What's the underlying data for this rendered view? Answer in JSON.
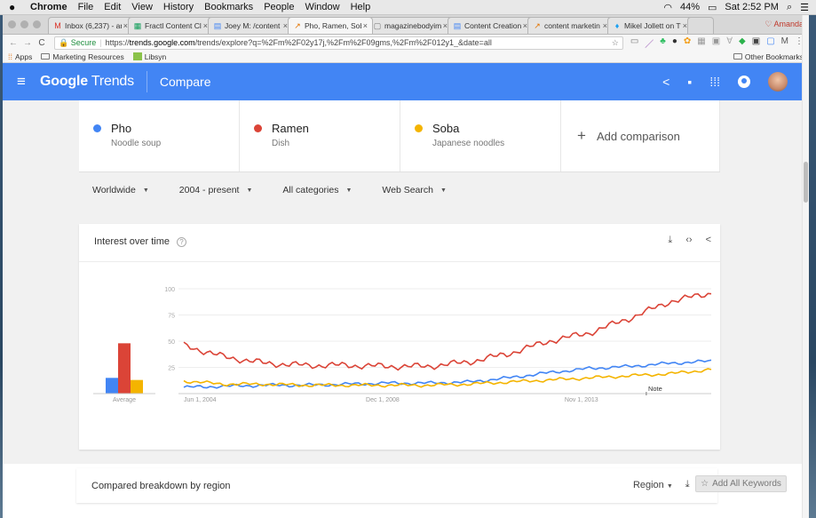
{
  "menubar": {
    "items": [
      "Chrome",
      "File",
      "Edit",
      "View",
      "History",
      "Bookmarks",
      "People",
      "Window",
      "Help"
    ],
    "battery": "44%",
    "clock": "Sat 2:52 PM"
  },
  "tabs": [
    {
      "label": "Inbox (6,237) - ar",
      "icon": "gmail-icon",
      "glyph": "M",
      "color": "#d93025"
    },
    {
      "label": "Fractl Content Cl",
      "icon": "sheets-icon",
      "glyph": "▦",
      "color": "#0f9d58"
    },
    {
      "label": "Joey M: /content",
      "icon": "docs-icon",
      "glyph": "▤",
      "color": "#4285f4"
    },
    {
      "label": "Pho, Ramen, Sob",
      "icon": "trends-icon",
      "glyph": "↗",
      "color": "#e37400",
      "active": true
    },
    {
      "label": "magazinebodyim",
      "icon": "page-icon",
      "glyph": "▢",
      "color": "#777777"
    },
    {
      "label": "Content Creation",
      "icon": "docs-icon",
      "glyph": "▤",
      "color": "#4285f4"
    },
    {
      "label": "content marketin",
      "icon": "trends-icon",
      "glyph": "↗",
      "color": "#e37400"
    },
    {
      "label": "Mikel Jollett on Tv",
      "icon": "twitter-icon",
      "glyph": "♦",
      "color": "#1da1f2"
    }
  ],
  "profile_name": "Amanda",
  "address": {
    "secure_label": "Secure",
    "url_prefix": "https://",
    "url_host": "trends.google.com",
    "url_path": "/trends/explore?q=%2Fm%2F02y17j,%2Fm%2F09gms,%2Fm%2F012y1_&date=all"
  },
  "bookmarks": {
    "apps": "Apps",
    "marketing": "Marketing Resources",
    "libsyn": "Libsyn",
    "other": "Other Bookmarks"
  },
  "header": {
    "logo_google": "Google",
    "logo_trends": "Trends",
    "section": "Compare"
  },
  "terms": [
    {
      "name": "Pho",
      "sub": "Noodle soup",
      "color": "#4285f4"
    },
    {
      "name": "Ramen",
      "sub": "Dish",
      "color": "#db4437"
    },
    {
      "name": "Soba",
      "sub": "Japanese noodles",
      "color": "#f4b400"
    }
  ],
  "add_comparison": "Add comparison",
  "filters": {
    "region": "Worldwide",
    "time": "2004 - present",
    "category": "All categories",
    "search_type": "Web Search"
  },
  "interest_card": {
    "title": "Interest over time",
    "help_glyph": "?",
    "average_label": "Average",
    "note_label": "Note"
  },
  "region_card": {
    "title": "Compared breakdown by region",
    "selector": "Region",
    "add_all": "Add All Keywords"
  },
  "chart_data": {
    "type": "line",
    "title": "Interest over time",
    "xlabel": "",
    "ylabel": "",
    "ylim": [
      0,
      100
    ],
    "yticks": [
      25,
      50,
      75,
      100
    ],
    "xticks": [
      "Jun 1, 2004",
      "Dec 1, 2008",
      "Nov 1, 2013"
    ],
    "grid": true,
    "x": [
      2004,
      2005,
      2006,
      2007,
      2008,
      2009,
      2010,
      2011,
      2012,
      2013,
      2014,
      2015,
      2016,
      2017
    ],
    "series": [
      {
        "name": "Pho",
        "color": "#4285f4",
        "values": [
          6,
          7,
          8,
          8,
          9,
          10,
          10,
          11,
          15,
          20,
          24,
          26,
          29,
          31
        ],
        "average": 15
      },
      {
        "name": "Ramen",
        "color": "#db4437",
        "values": [
          46,
          35,
          29,
          27,
          27,
          26,
          26,
          30,
          38,
          50,
          58,
          72,
          88,
          96
        ],
        "average": 48
      },
      {
        "name": "Soba",
        "color": "#f4b400",
        "values": [
          12,
          9,
          9,
          8,
          8,
          8,
          8,
          9,
          11,
          13,
          15,
          17,
          19,
          23
        ],
        "average": 13
      }
    ]
  }
}
